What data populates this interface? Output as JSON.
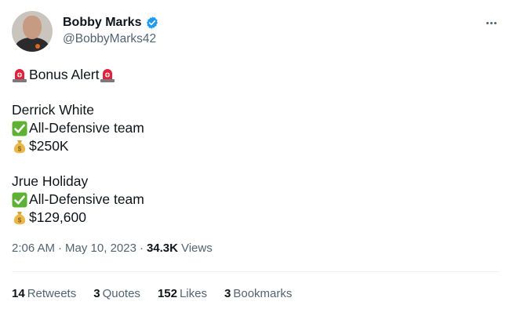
{
  "author": {
    "display_name": "Bobby Marks",
    "handle": "@BobbyMarks42",
    "verified_icon": "verified-badge-icon",
    "verified_color": "#1d9bf0"
  },
  "menu_icon": "more-dots-icon",
  "body": {
    "alert_text": "Bonus Alert",
    "player1": {
      "name": "Derrick White",
      "award": "All-Defensive team",
      "amount": "$250K"
    },
    "player2": {
      "name": "Jrue Holiday",
      "award": "All-Defensive team",
      "amount": "$129,600"
    }
  },
  "meta": {
    "time": "2:06 AM",
    "date": "May 10, 2023",
    "views_count": "34.3K",
    "views_label": "Views",
    "separator": "·"
  },
  "stats": {
    "retweets_count": "14",
    "retweets_label": "Retweets",
    "quotes_count": "3",
    "quotes_label": "Quotes",
    "likes_count": "152",
    "likes_label": "Likes",
    "bookmarks_count": "3",
    "bookmarks_label": "Bookmarks"
  },
  "colors": {
    "text": "#0f1419",
    "secondary": "#536471",
    "divider": "#eff3f4"
  }
}
